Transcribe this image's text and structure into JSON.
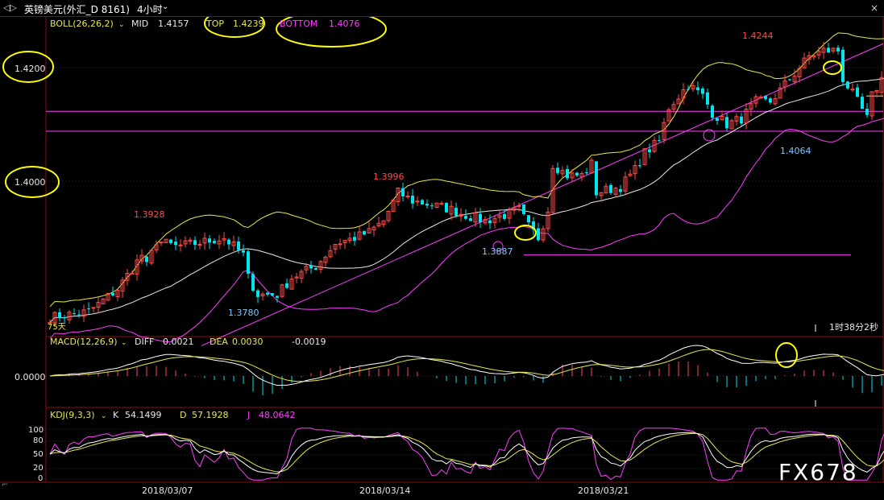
{
  "window": {
    "icon_label": "◁▷",
    "symbol_title": "英镑美元(外汇_D 8161)",
    "timeframe": "4小时",
    "close_button": "×"
  },
  "main_panel": {
    "indicator_name": "BOLL(26,26,2)",
    "mid_label": "MID",
    "mid_value": "1.4157",
    "top_label": "TOP",
    "top_value": "1.4239",
    "bottom_label": "BOTTOM",
    "bottom_value": "1.4076",
    "y_ticks": [
      "1.4200",
      "1.4000"
    ],
    "price_labels": [
      "1.4244",
      "1.3928",
      "1.3996",
      "1.3887",
      "1.3780",
      "1.4064"
    ],
    "countdown": "1时38分2秒",
    "day_count": "75天"
  },
  "macd_panel": {
    "indicator_name": "MACD(12,26,9)",
    "diff_label": "DIFF",
    "diff_value": "0.0021",
    "dea_label": "DEA",
    "dea_value": "0.0030",
    "macd_value": "-0.0019",
    "y_tick": "0.0000"
  },
  "kdj_panel": {
    "indicator_name": "KDJ(9,3,3)",
    "k_label": "K",
    "k_value": "54.1499",
    "d_label": "D",
    "d_value": "57.1928",
    "j_label": "J",
    "j_value": "48.0642",
    "y_ticks": [
      "100",
      "80",
      "50",
      "20",
      "0"
    ]
  },
  "x_axis": {
    "dates": [
      "2018/03/07",
      "2018/03/14",
      "2018/03/21"
    ]
  },
  "watermark": "FX678",
  "colors": {
    "bull": "#ff4a4a",
    "bear": "#00e5ee",
    "boll_upper": "#e8e84a",
    "boll_mid": "#e8e8e8",
    "boll_lower": "#ff3cff",
    "trendline": "#ff3cff",
    "annotation": "#ffff00",
    "level_line": "#ff3cff",
    "grid": "#7a1010"
  },
  "chart_data": {
    "type": "candlestick",
    "timeframe": "4h",
    "ylim": [
      1.371,
      1.4285
    ],
    "bollinger": {
      "period": 26,
      "k": 2,
      "mid": 1.4157,
      "top": 1.4239,
      "bottom": 1.4076
    },
    "annotated_prices": {
      "high_1": 1.3928,
      "high_2": 1.3996,
      "high_3": 1.4244,
      "low_1": 1.378,
      "low_2": 1.3887,
      "low_3": 1.4064
    },
    "horizontal_levels": [
      1.4123,
      1.4088,
      1.387
    ],
    "macd": {
      "fast": 12,
      "slow": 26,
      "signal": 9,
      "diff": 0.0021,
      "dea": 0.003,
      "macd": -0.0019
    },
    "kdj": {
      "n": 9,
      "m1": 3,
      "m2": 3,
      "k": 54.1499,
      "d": 57.1928,
      "j": 48.0642
    },
    "date_ticks": [
      "2018/03/07",
      "2018/03/14",
      "2018/03/21"
    ]
  }
}
